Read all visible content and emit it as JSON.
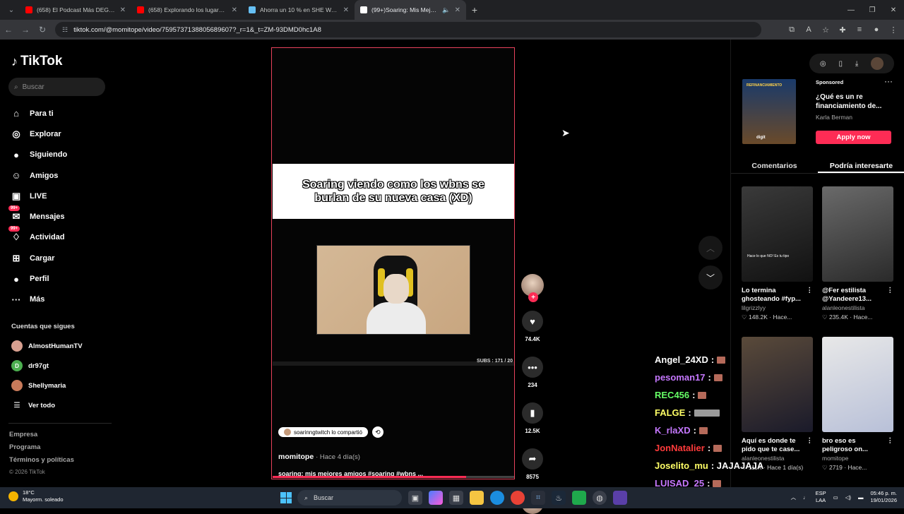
{
  "browser": {
    "tabs": [
      {
        "title": "(658) El Podcast Más DEGENERADO",
        "favicon_color": "#ff0000"
      },
      {
        "title": "(658) Explorando los lugares más",
        "favicon_color": "#ff0000"
      },
      {
        "title": "Ahorra un 10 % en SHE WAS SH",
        "favicon_color": "#66c0f4"
      },
      {
        "title": "(99+)Soaring: Mis Mejores A",
        "favicon_color": "#ffffff",
        "active": true
      }
    ],
    "url": "tiktok.com/@momitope/video/7595737138805689607?_r=1&_t=ZM-93DMD0hc1A8"
  },
  "sidebar": {
    "logo": "TikTok",
    "search_placeholder": "Buscar",
    "nav": [
      {
        "label": "Para ti",
        "icon": "home-icon"
      },
      {
        "label": "Explorar",
        "icon": "compass-icon"
      },
      {
        "label": "Siguiendo",
        "icon": "following-avatar-icon"
      },
      {
        "label": "Amigos",
        "icon": "friends-icon"
      },
      {
        "label": "LIVE",
        "icon": "live-icon"
      },
      {
        "label": "Mensajes",
        "icon": "messages-icon",
        "badge": "99+"
      },
      {
        "label": "Actividad",
        "icon": "activity-icon",
        "badge": "99+"
      },
      {
        "label": "Cargar",
        "icon": "upload-icon"
      },
      {
        "label": "Perfil",
        "icon": "profile-icon"
      },
      {
        "label": "Más",
        "icon": "more-icon"
      }
    ],
    "following_title": "Cuentas que sigues",
    "following": [
      {
        "name": "AlmostHumanTV",
        "avatar_color": "#d8a090"
      },
      {
        "name": "dr97gt",
        "avatar_color": "#4caf50",
        "initial": "D"
      },
      {
        "name": "Shellymaria",
        "avatar_color": "#c87a5a"
      }
    ],
    "see_all": "Ver todo",
    "footer": [
      "Empresa",
      "Programa",
      "Términos y políticas"
    ],
    "copyright": "© 2026 TikTok"
  },
  "video": {
    "caption": "Soaring viendo como los wbns se burlan de su nueva casa (XD)",
    "subs_label": "SUBS : 171 / 20",
    "shared_by": "soarinngtwitch lo compartió",
    "author": "momitope",
    "posted": "· Hace 4 día(s)",
    "description": "soaring: mis mejores amigos #soaring #wbns ...",
    "progress": 0.8,
    "likes": "74.4K",
    "comments": "234",
    "saves": "12.5K",
    "shares": "8575"
  },
  "right_panel": {
    "ad": {
      "thumb_label": "REFINANCIAMIENTO",
      "thumb_brand": "digit",
      "sponsored": "Sponsored",
      "title": "¿Qué es un re financiamiento de...",
      "author": "Karla Berman",
      "cta": "Apply now"
    },
    "tabs": [
      "Comentarios",
      "Podría interesarte"
    ],
    "cards": [
      {
        "title": "Lo termina ghosteando #fyp...",
        "author": "lilgrizzlyy",
        "stats": "♡ 148.2K · Hace...",
        "thumb_text": "Hace lo que NO! Es tu tipo",
        "colors": [
          "#3a3a3a",
          "#111111"
        ]
      },
      {
        "title": "@Fer estilista @Yandeere13...",
        "author": "alanleonestilista",
        "stats": "♡ 235.4K · Hace...",
        "colors": [
          "#6a6a6a",
          "#2a2a2a"
        ]
      },
      {
        "title": "Aquí es donde te pido que te case...",
        "author": "alanleonestilista",
        "stats": "♡ 111K · Hace 1 día(s)",
        "colors": [
          "#5a4a3a",
          "#1a1a2a"
        ]
      },
      {
        "title": "bro eso es peligroso on...",
        "author": "momitope",
        "stats": "♡ 2719 · Hace...",
        "colors": [
          "#e8e8e8",
          "#b8c0d8"
        ]
      }
    ]
  },
  "chat": [
    {
      "user": "Angel_24XD",
      "color": "#ffffff",
      "suffix": ":"
    },
    {
      "user": "pesoman17",
      "color": "#c678ff",
      "suffix": ":"
    },
    {
      "user": "REC456",
      "color": "#66ff66",
      "suffix": ":"
    },
    {
      "user": "FALGE",
      "color": "#ffff66",
      "suffix": ":"
    },
    {
      "user": "K_rlaXD",
      "color": "#c678ff",
      "suffix": ":"
    },
    {
      "user": "JonNatalier",
      "color": "#ff3b3b",
      "suffix": ":"
    },
    {
      "user": "Joselito_mu",
      "color": "#ffff66",
      "suffix": ": JAJAJAJA"
    },
    {
      "user": "LUISAD_25",
      "color": "#c678ff",
      "suffix": ":"
    }
  ],
  "taskbar": {
    "temp": "18°C",
    "weather": "Mayorm. soleado",
    "search": "Buscar",
    "lang1": "ESP",
    "lang2": "LAA",
    "time": "05:46 p. m.",
    "date": "19/01/2026"
  }
}
